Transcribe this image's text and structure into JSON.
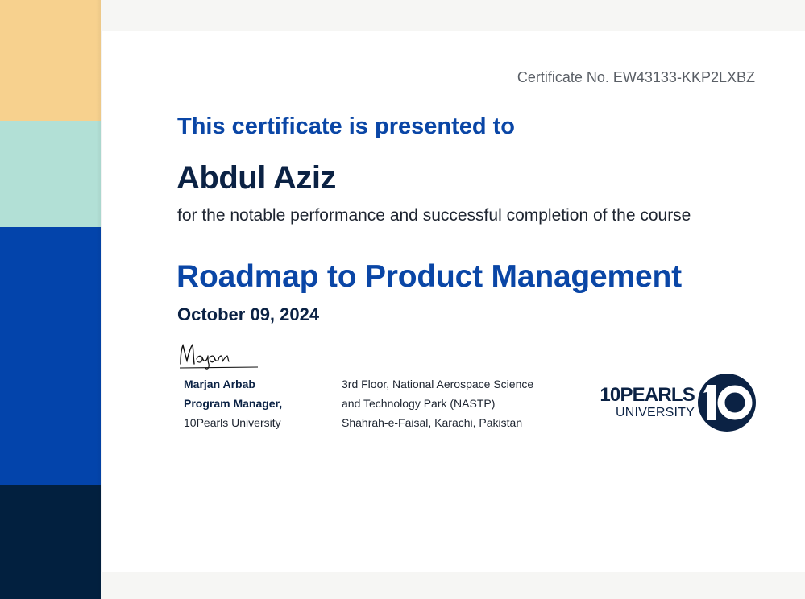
{
  "certificate": {
    "number": "Certificate No. EW43133-KKP2LXBZ",
    "heading": "This certificate is presented to",
    "recipient": "Abdul Aziz",
    "reason": "for the notable performance and successful completion of the course",
    "course": "Roadmap to Product Management",
    "date": "October 09, 2024"
  },
  "signature": {
    "signer_name": "Marjan Arbab",
    "signer_role": "Program Manager,",
    "signer_org": "10Pearls University"
  },
  "address": {
    "line1": "3rd Floor, National Aerospace Science",
    "line2": "and Technology Park (NASTP)",
    "line3": "Shahrah-e-Faisal, Karachi, Pakistan"
  },
  "logo": {
    "brand": "10PEARLS",
    "subtitle": "UNIVERSITY",
    "mark_icon": "ten-logo-icon"
  },
  "colors": {
    "primary_blue": "#0a46a6",
    "navy": "#0b2244",
    "stripe_yellow": "#f7d18e",
    "stripe_mint": "#b2e0d6",
    "stripe_blue": "#0344ab",
    "stripe_navy": "#02203f"
  }
}
